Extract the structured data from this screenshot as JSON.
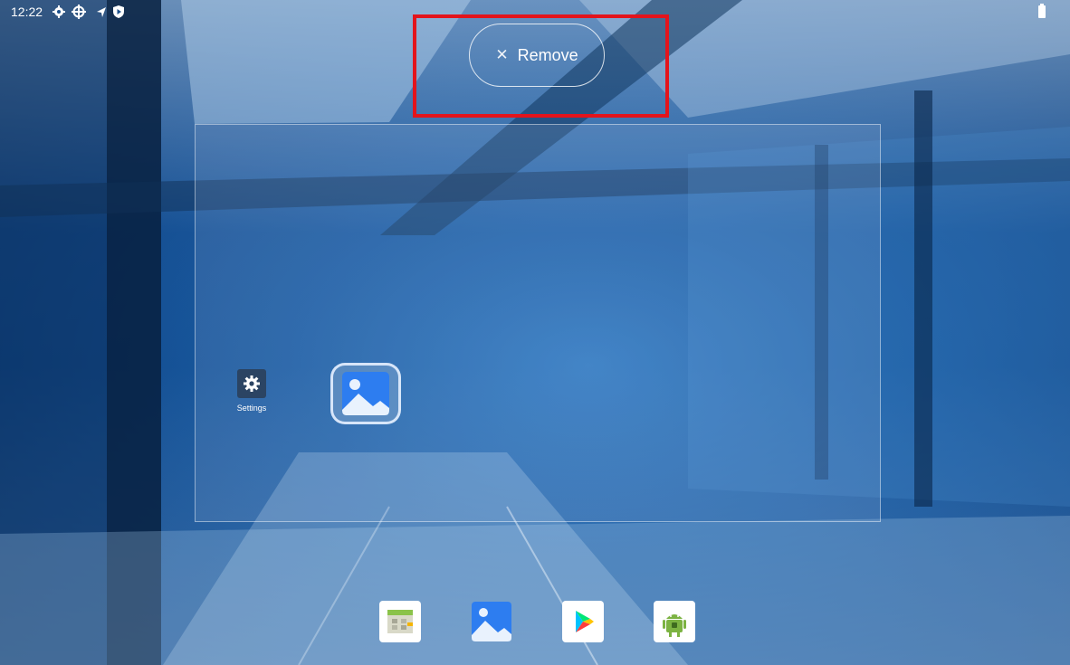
{
  "status_bar": {
    "time": "12:22",
    "icons": [
      "settings-icon",
      "crosshair-icon",
      "navigation-icon",
      "shield-icon",
      "battery-icon"
    ]
  },
  "drop_target": {
    "remove_label": "Remove",
    "remove_icon": "close-icon"
  },
  "workspace": {
    "apps": [
      {
        "label": "Settings",
        "icon": "gear-icon"
      }
    ],
    "dragged_app": {
      "icon": "gallery-icon"
    }
  },
  "dock": {
    "apps": [
      {
        "icon": "calendar-map-icon"
      },
      {
        "icon": "gallery-icon"
      },
      {
        "icon": "play-store-icon"
      },
      {
        "icon": "android-icon"
      }
    ]
  },
  "colors": {
    "highlight": "#e3141c",
    "wallpaper": "#14487f"
  }
}
